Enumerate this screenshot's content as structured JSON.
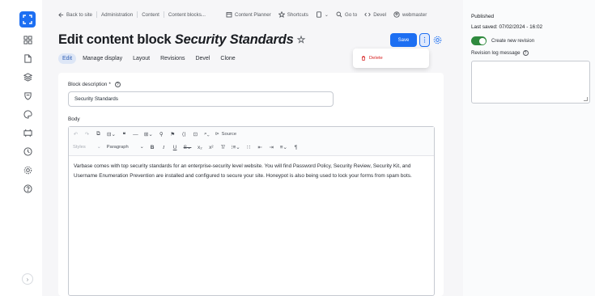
{
  "breadcrumb": {
    "back": "Back to site",
    "items": [
      "Administration",
      "Content",
      "Content blocks..."
    ]
  },
  "toolbar": {
    "content_planner": "Content Planner",
    "shortcuts": "Shortcuts",
    "go_to": "Go to",
    "devel": "Devel",
    "user": "webmaster"
  },
  "page": {
    "title_prefix": "Edit content block ",
    "title_entity": "Security Standards"
  },
  "actions": {
    "save": "Save",
    "more": "⋮",
    "delete": "Delete"
  },
  "tabs": [
    "Edit",
    "Manage display",
    "Layout",
    "Revisions",
    "Devel",
    "Clone"
  ],
  "form": {
    "block_description_label": "Block description",
    "required_mark": "*",
    "block_description_value": "Security Standards",
    "body_label": "Body",
    "help_glyph": "?"
  },
  "editor": {
    "source_label": "Source",
    "style_select": "Styles",
    "heading_select": "Paragraph",
    "body_text": "Varbase comes with top security standards for an enterprise-security level website. You will find Password Policy, Security Review, Security Kit, and Username Enumeration Prevention are installed and configured to secure your site. Honeypot is also being used to lock your forms from spam bots."
  },
  "sidebar": {
    "status": "Published",
    "last_saved": "Last saved: 07/02/2024 - 16:02",
    "create_revision_label": "Create new revision",
    "create_revision_on": true,
    "revision_log_label": "Revision log message"
  },
  "colors": {
    "accent": "#1d6ff2",
    "danger": "#d72222",
    "toggle_on": "#2f8a3e"
  }
}
